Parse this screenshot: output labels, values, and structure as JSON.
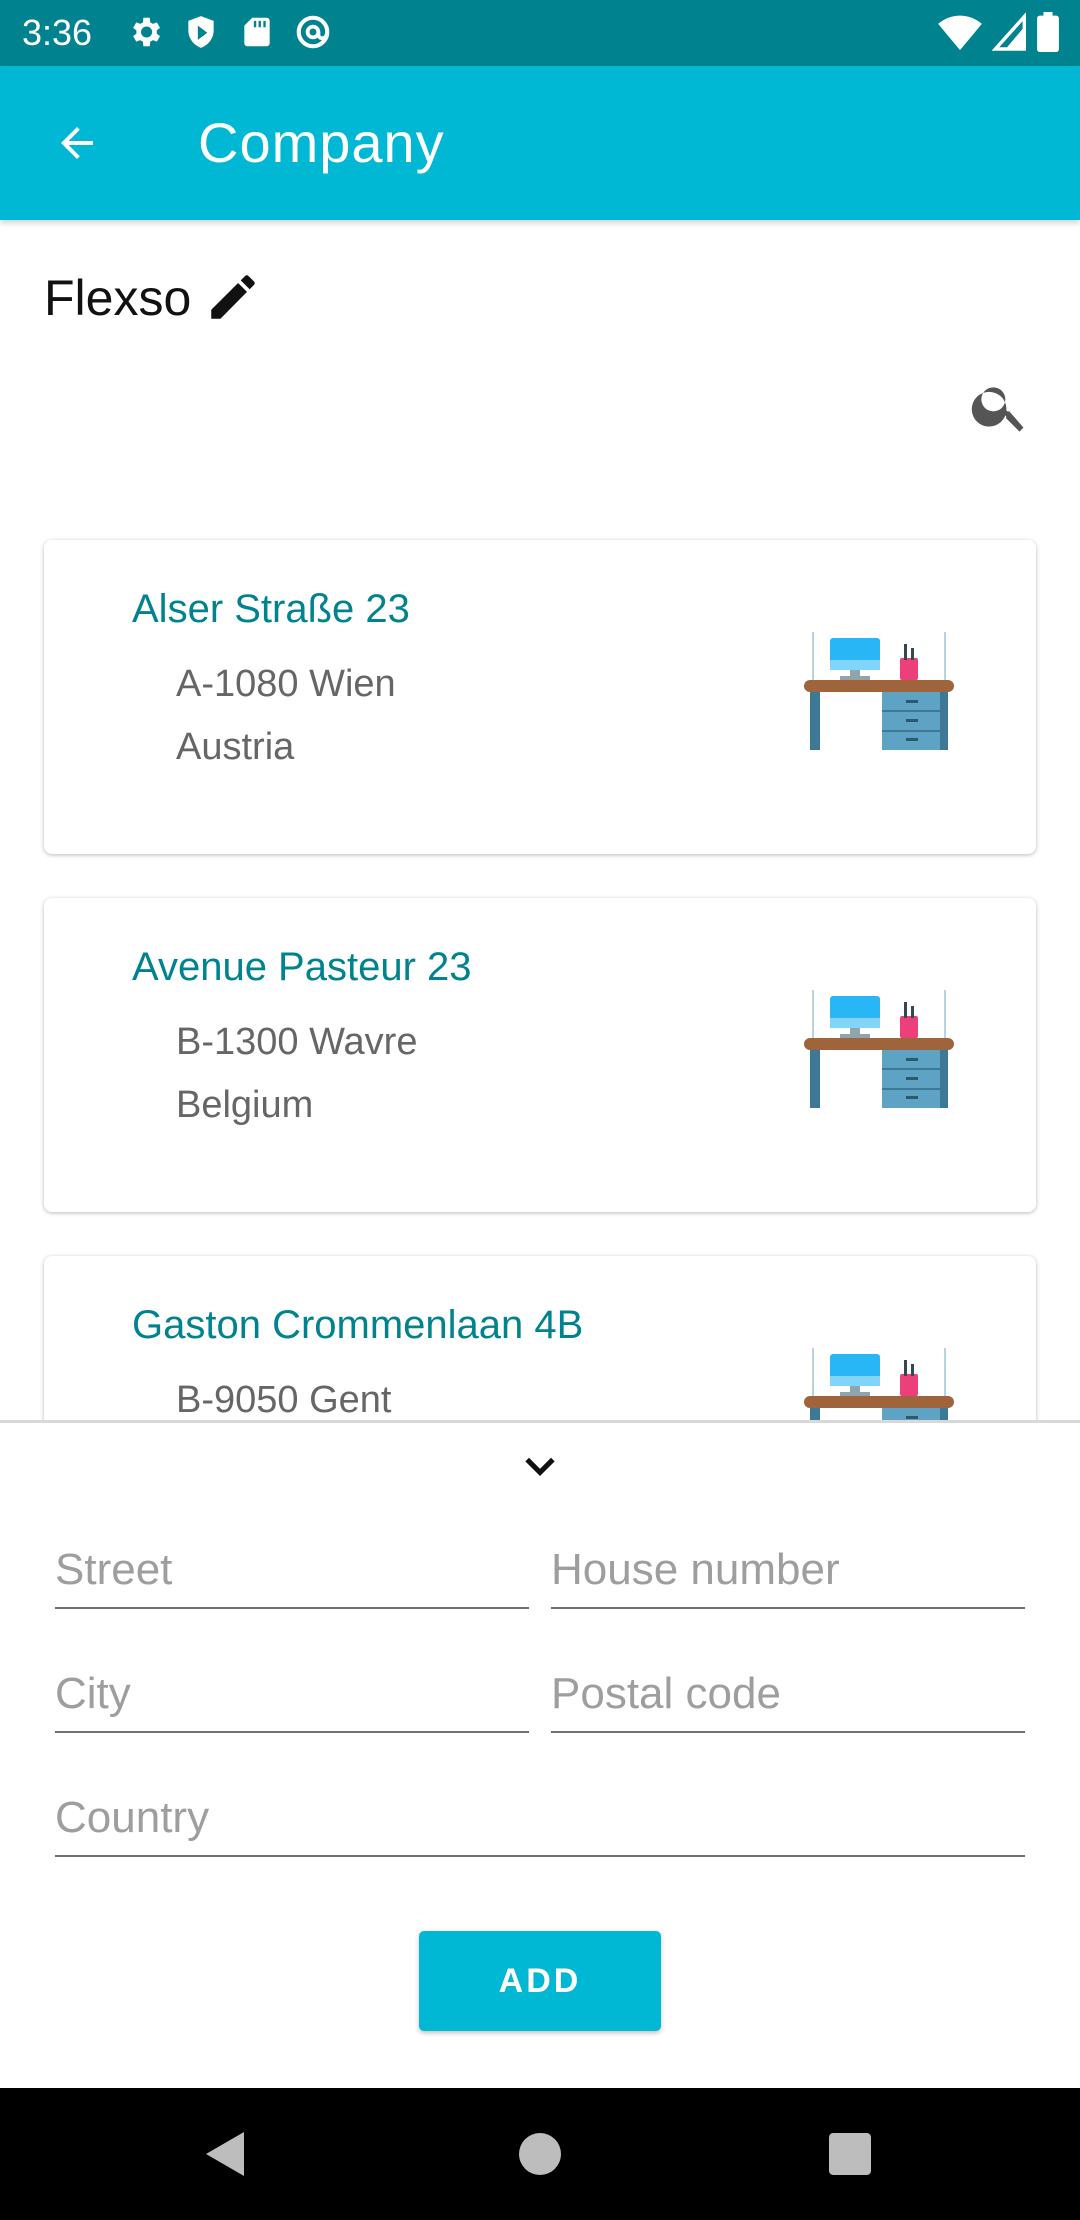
{
  "status_bar": {
    "time": "3:36",
    "left_icons": [
      "settings-icon",
      "shield-icon",
      "sd-card-icon",
      "at-sign-icon"
    ],
    "right_icons": [
      "wifi-icon",
      "signal-icon",
      "battery-icon"
    ]
  },
  "app_bar": {
    "title": "Company",
    "back_icon": "arrow-left-icon"
  },
  "company": {
    "name": "Flexso",
    "edit_icon": "pencil-icon",
    "search_icon": "search-icon"
  },
  "addresses": [
    {
      "street": "Alser Straße 23",
      "city": "A-1080 Wien",
      "country": "Austria",
      "icon": "office-desk-icon"
    },
    {
      "street": "Avenue Pasteur 23",
      "city": "B-1300 Wavre",
      "country": "Belgium",
      "icon": "office-desk-icon"
    },
    {
      "street": "Gaston Crommenlaan 4B",
      "city": "B-9050 Gent",
      "country": "",
      "icon": "office-desk-icon"
    }
  ],
  "form": {
    "collapse_icon": "chevron-down-icon",
    "street_placeholder": "Street",
    "house_number_placeholder": "House number",
    "city_placeholder": "City",
    "postal_code_placeholder": "Postal code",
    "country_placeholder": "Country",
    "add_label": "ADD"
  },
  "colors": {
    "status_bar": "#00838f",
    "app_bar": "#00b8d4",
    "accent_text": "#00838f",
    "button": "#00b8d4"
  },
  "nav_bar": {
    "icons": [
      "back-triangle-icon",
      "home-circle-icon",
      "recents-square-icon"
    ]
  }
}
